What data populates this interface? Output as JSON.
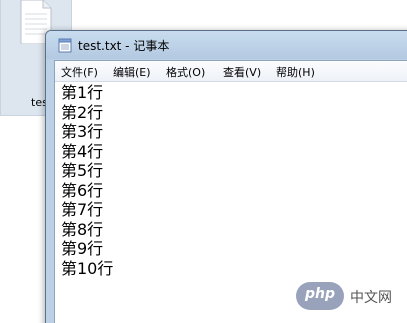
{
  "desktop": {
    "file_label": "tes",
    "file_icon": "text-file-icon"
  },
  "window": {
    "title": "test.txt - 记事本",
    "icon": "notepad-icon"
  },
  "menu": [
    {
      "label": "文件(F)"
    },
    {
      "label": "编辑(E)"
    },
    {
      "label": "格式(O)"
    },
    {
      "label": "查看(V)"
    },
    {
      "label": "帮助(H)"
    }
  ],
  "editor": {
    "lines": [
      "第1行",
      "第2行",
      "第3行",
      "第4行",
      "第5行",
      "第6行",
      "第7行",
      "第8行",
      "第9行",
      "第10行"
    ]
  },
  "watermark": {
    "badge": "php",
    "text": "中文网"
  }
}
